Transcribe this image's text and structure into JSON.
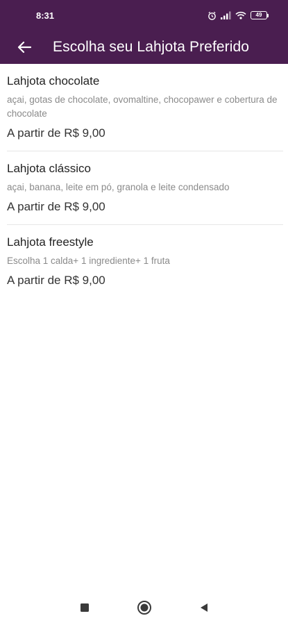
{
  "status": {
    "time": "8:31",
    "battery": "49",
    "icons": [
      "alarm-icon",
      "signal-icon",
      "wifi-icon",
      "battery-icon"
    ]
  },
  "header": {
    "title": "Escolha seu Lahjota Preferido",
    "back_icon": "arrow-left-icon"
  },
  "products": [
    {
      "name": "Lahjota chocolate",
      "description": "açai, gotas de chocolate, ovomaltine, chocopawer e cobertura de chocolate",
      "price": "A partir de R$ 9,00"
    },
    {
      "name": "Lahjota clássico",
      "description": "açai, banana, leite em pó, granola e leite condensado",
      "price": "A partir de R$ 9,00"
    },
    {
      "name": "Lahjota freestyle",
      "description": "Escolha 1 calda+ 1 ingrediente+ 1 fruta",
      "price": "A partir de R$ 9,00"
    }
  ],
  "nav": {
    "icons": [
      "recents-square-icon",
      "home-circle-icon",
      "back-triangle-icon"
    ]
  },
  "colors": {
    "primary": "#4a1e50",
    "on_primary": "#ffffff",
    "title_text": "#222222",
    "secondary_text": "#8a8a8a",
    "divider": "#e6e6e6"
  }
}
